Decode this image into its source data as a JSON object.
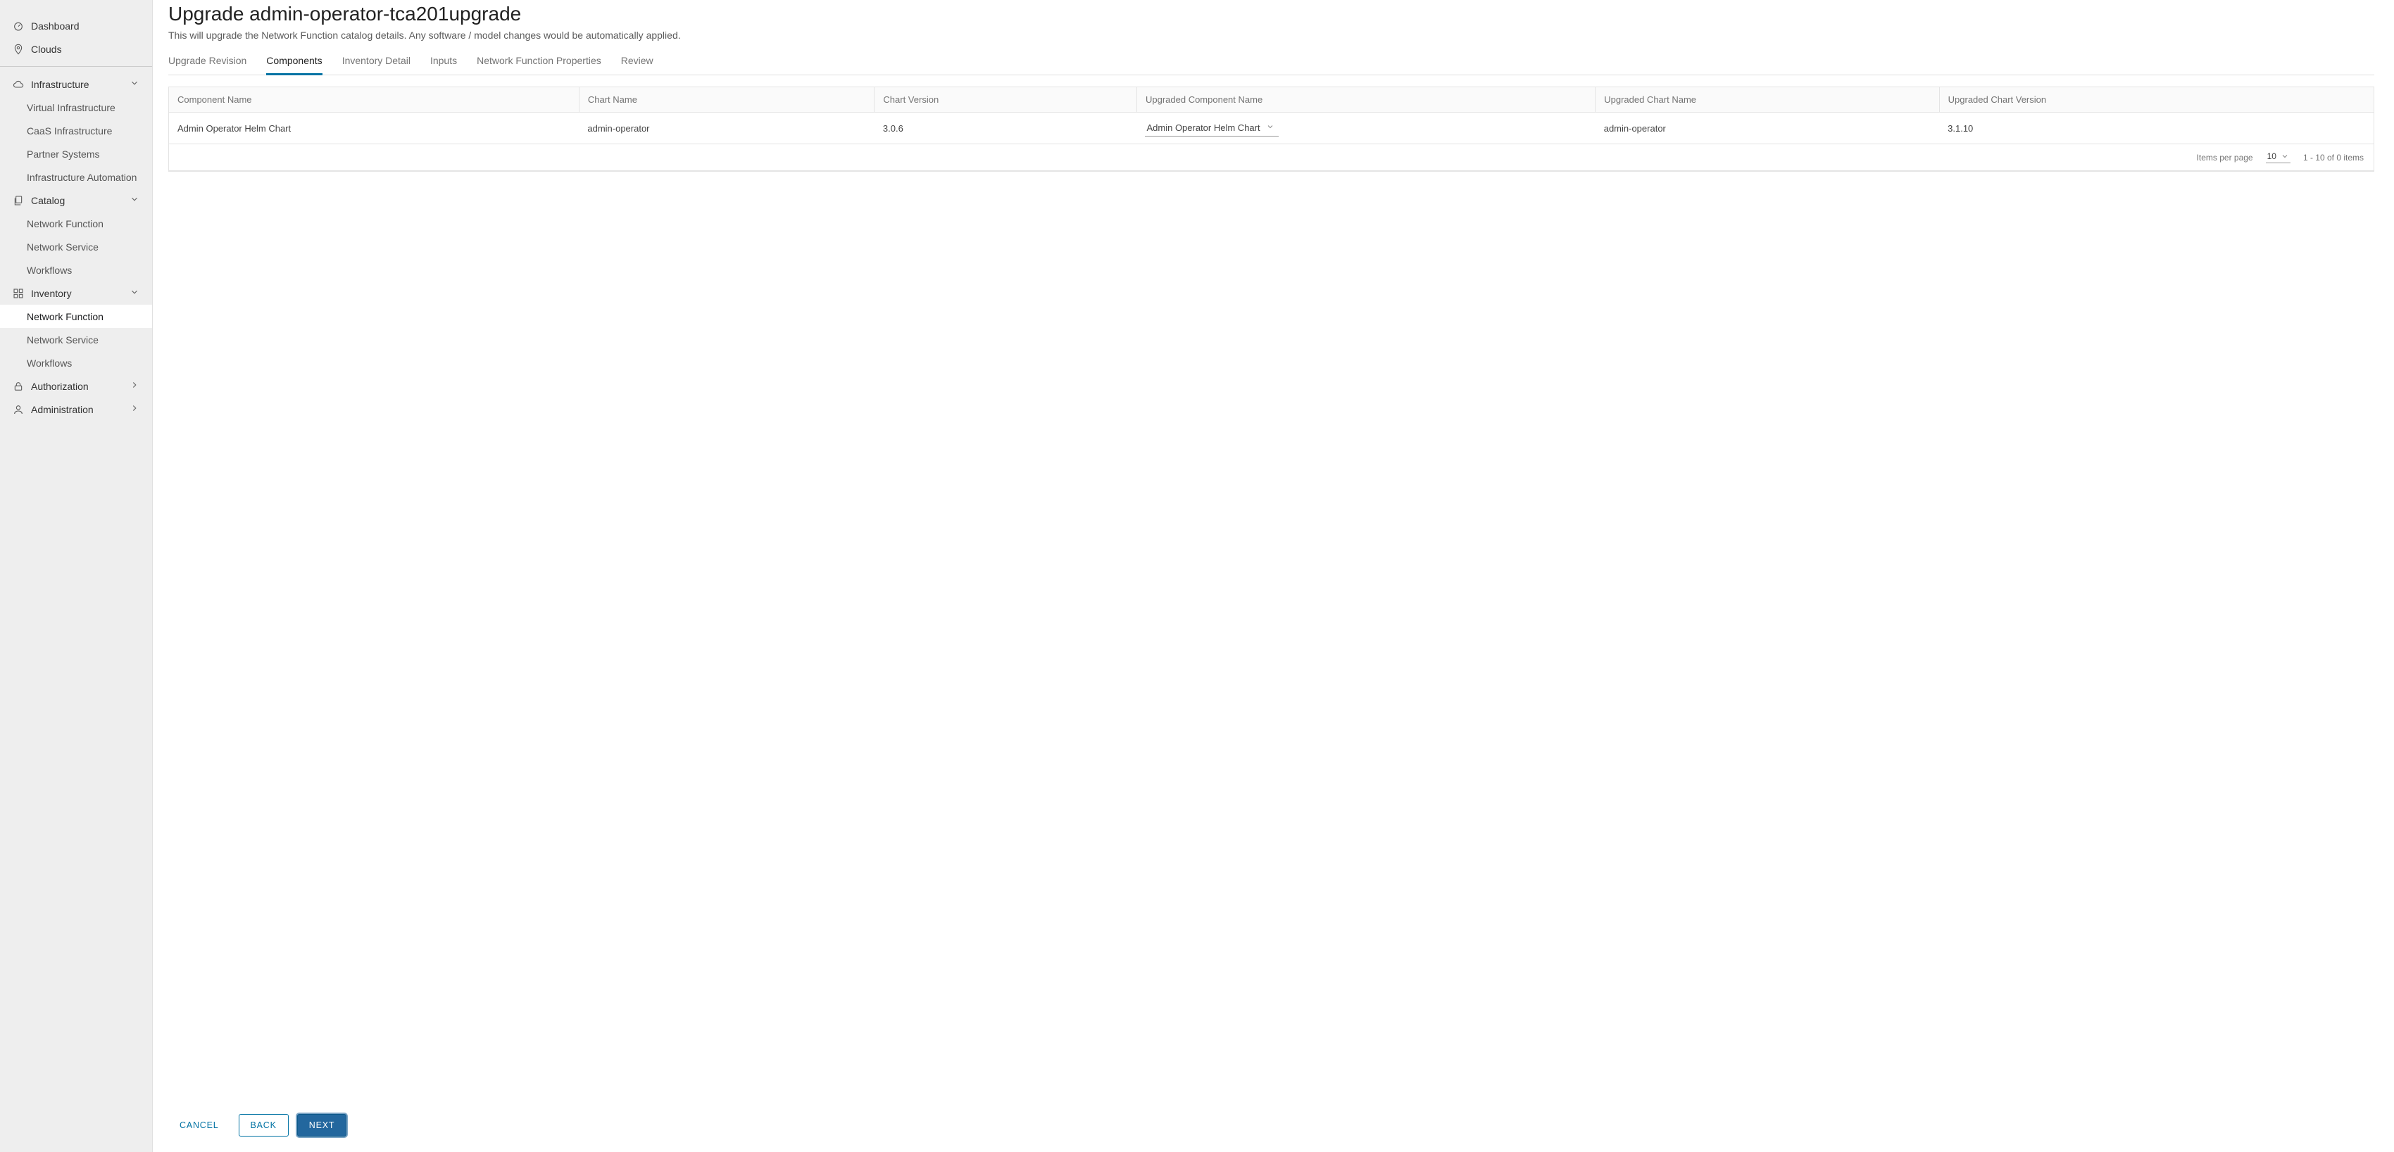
{
  "sidebar": {
    "top": [
      {
        "label": "Dashboard",
        "icon": "dashboard"
      },
      {
        "label": "Clouds",
        "icon": "pin"
      }
    ],
    "infrastructure": {
      "label": "Infrastructure",
      "icon": "cloud",
      "expanded": true,
      "items": [
        {
          "label": "Virtual Infrastructure"
        },
        {
          "label": "CaaS Infrastructure"
        },
        {
          "label": "Partner Systems"
        },
        {
          "label": "Infrastructure Automation"
        }
      ]
    },
    "catalog": {
      "label": "Catalog",
      "icon": "copy",
      "expanded": true,
      "items": [
        {
          "label": "Network Function"
        },
        {
          "label": "Network Service"
        },
        {
          "label": "Workflows"
        }
      ]
    },
    "inventory": {
      "label": "Inventory",
      "icon": "grid",
      "expanded": true,
      "items": [
        {
          "label": "Network Function",
          "active": true
        },
        {
          "label": "Network Service"
        },
        {
          "label": "Workflows"
        }
      ]
    },
    "authorization": {
      "label": "Authorization",
      "icon": "lock",
      "expanded": false
    },
    "administration": {
      "label": "Administration",
      "icon": "user",
      "expanded": false
    }
  },
  "page": {
    "title": "Upgrade admin-operator-tca201upgrade",
    "subtitle": "This will upgrade the Network Function catalog details. Any software / model changes would be automatically applied."
  },
  "tabs": [
    {
      "label": "Upgrade Revision",
      "active": false
    },
    {
      "label": "Components",
      "active": true
    },
    {
      "label": "Inventory Detail",
      "active": false
    },
    {
      "label": "Inputs",
      "active": false
    },
    {
      "label": "Network Function Properties",
      "active": false
    },
    {
      "label": "Review",
      "active": false
    }
  ],
  "table": {
    "headers": {
      "component_name": "Component Name",
      "chart_name": "Chart Name",
      "chart_version": "Chart Version",
      "upgraded_component_name": "Upgraded Component Name",
      "upgraded_chart_name": "Upgraded Chart Name",
      "upgraded_chart_version": "Upgraded Chart Version"
    },
    "rows": [
      {
        "component_name": "Admin Operator Helm Chart",
        "chart_name": "admin-operator",
        "chart_version": "3.0.6",
        "upgraded_component_name": "Admin Operator Helm Chart",
        "upgraded_chart_name": "admin-operator",
        "upgraded_chart_version": "3.1.10"
      }
    ],
    "pagination": {
      "items_per_page_label": "Items per page",
      "items_per_page_value": "10",
      "range_text": "1 - 10 of 0 items"
    }
  },
  "footer": {
    "cancel": "CANCEL",
    "back": "BACK",
    "next": "NEXT"
  }
}
